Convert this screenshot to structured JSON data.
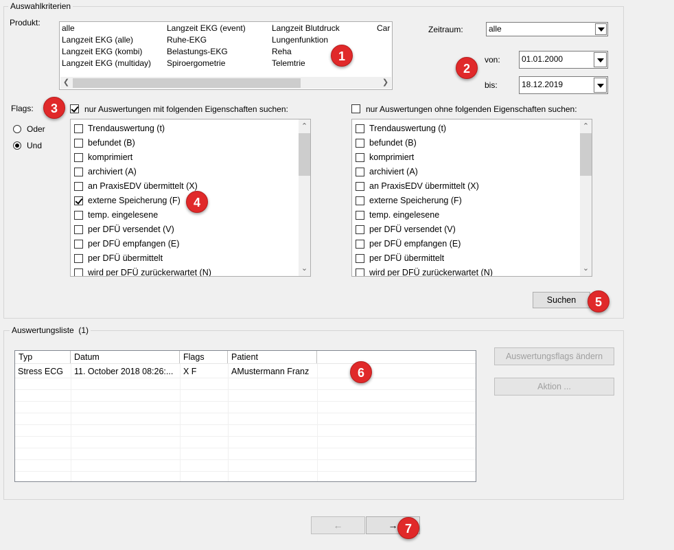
{
  "criteria": {
    "title": "Auswahlkriterien",
    "product_label": "Produkt:",
    "products": [
      [
        "alle",
        "Langzeit EKG (alle)",
        "Langzeit EKG (kombi)",
        "Langzeit EKG (multiday)"
      ],
      [
        "Langzeit EKG (event)",
        "Ruhe-EKG",
        "Belastungs-EKG",
        "Spiroergometrie"
      ],
      [
        "Langzeit Blutdruck",
        "Lungenfunktion",
        "Reha",
        "Telemtrie"
      ],
      [
        "Car"
      ]
    ],
    "zeitraum_label": "Zeitraum:",
    "zeitraum_value": "alle",
    "von_label": "von:",
    "von_value": "01.01.2000",
    "bis_label": "bis:",
    "bis_value": "18.12.2019",
    "flags_label": "Flags:",
    "logic_options": [
      "Oder",
      "Und"
    ],
    "logic_selected": "Und",
    "with_flags_label": "nur Auswertungen mit folgenden Eigenschaften suchen:",
    "with_flags_checked": true,
    "without_flags_label": "nur Auswertungen ohne folgenden Eigenschaften suchen:",
    "without_flags_checked": false,
    "flag_items": [
      "Trendauswertung (t)",
      "befundet (B)",
      "komprimiert",
      "archiviert (A)",
      "an PraxisEDV übermittelt (X)",
      "externe Speicherung (F)",
      "temp. eingelesene",
      "per DFÜ versendet (V)",
      "per DFÜ empfangen (E)",
      "per DFÜ übermittelt",
      "wird per DFÜ zurückerwartet (N)"
    ],
    "with_flags_checked_items": [
      false,
      false,
      false,
      false,
      false,
      true,
      false,
      false,
      false,
      false,
      false
    ],
    "without_flags_checked_items": [
      false,
      false,
      false,
      false,
      false,
      false,
      false,
      false,
      false,
      false,
      false
    ],
    "search_button": "Suchen"
  },
  "results": {
    "title": "Auswertungsliste",
    "count": "(1)",
    "columns": [
      "Typ",
      "Datum",
      "Flags",
      "Patient"
    ],
    "rows": [
      [
        "Stress ECG",
        "11. October 2018 08:26:...",
        "X F",
        "AMustermann Franz"
      ]
    ],
    "change_flags_button": "Auswertungsflags ändern",
    "action_button": "Aktion ..."
  },
  "nav": {
    "back_label": "←",
    "next_label": "→"
  },
  "badges": [
    "1",
    "2",
    "3",
    "4",
    "5",
    "6",
    "7"
  ],
  "colors": {
    "badge": "#e0292a",
    "window_bg": "#f0f0f0"
  }
}
